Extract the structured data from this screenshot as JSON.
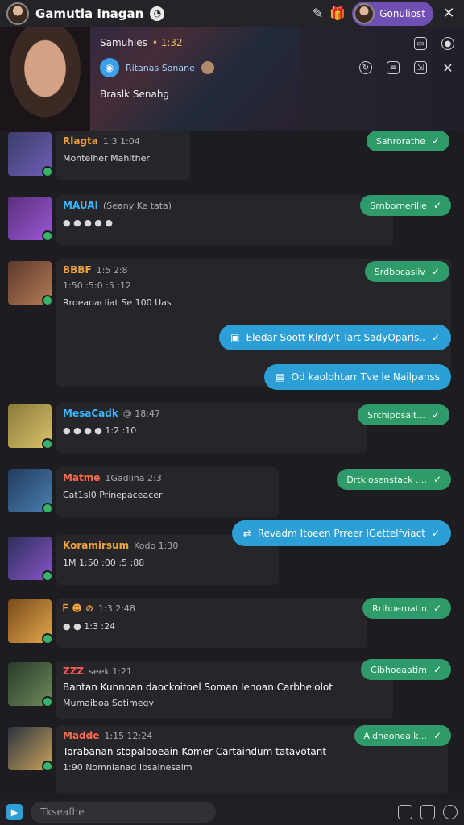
{
  "topbar": {
    "title": "Gamutla Inagan",
    "profile_name": "Gonuliost"
  },
  "hero": {
    "line1": "Samuhies",
    "line1_meta": "• 1:32",
    "sub_label": "Ritanas Sonane",
    "line3": "Braslk Senahg"
  },
  "chats": [
    {
      "name": "Rlagta",
      "name_color": "#f2a23a",
      "time": "1:3 1:04",
      "msg": "Montelher Mahlther",
      "status": "Sahrorathe",
      "avatar": [
        "#3a3e6a",
        "#6f5db5"
      ]
    },
    {
      "name": "MAUAI",
      "name_color": "#37b7ff",
      "time": "(Seany Ke tata)",
      "msg": "● ● ● ● ●",
      "status": "Srnbornerille",
      "avatar": [
        "#5a2f7a",
        "#9b57d6"
      ]
    },
    {
      "name": "BBBF",
      "name_color": "#f2a23a",
      "time": "1:5 2:8",
      "msg": "Rroeaoacliat Se 100 Uas",
      "msg_sub": "1:50 :5:0 :5 :12",
      "status": "Srdbocasiiv",
      "avatar": [
        "#5c3a2c",
        "#b57a56"
      ]
    },
    {
      "name": "MesaCadk",
      "name_color": "#37b7ff",
      "time": "@ 18:47",
      "msg": "● ● ● ● 1:2 :10",
      "status": "Srchipbsalt...",
      "avatar": [
        "#8a7a3a",
        "#d8c26a"
      ]
    },
    {
      "name": "Matme",
      "name_color": "#ff6b4a",
      "time": "1Gadiina 2:3",
      "msg": "Cat1sI0 Prinepaceacer",
      "status": "Drtklosenstack ....",
      "avatar": [
        "#223b5c",
        "#4a7fb0"
      ]
    },
    {
      "name": "Koramirsum",
      "name_color": "#f2a23a",
      "time": "Kodo 1:30",
      "msg": "1M 1:50 :00 :5 :88",
      "status": "",
      "avatar": [
        "#2c2f5a",
        "#8a54c8"
      ]
    },
    {
      "name": "ᖴ ☻ ⊘",
      "name_color": "#f2a23a",
      "time": "1:3 2:48",
      "msg": "● ● 1:3 :24",
      "status": "Rrihoeroatin",
      "avatar": [
        "#7a4a1a",
        "#e0a84a"
      ]
    },
    {
      "name": "ZZZ",
      "name_color": "#ff5a5a",
      "time": "seek 1:21",
      "msg": "Bantan Kunnoan daockoitoel Soman Ienoan Carbheiolot",
      "msg2": "Mumaiboa Sotimegy",
      "status": "Cibhoeaatim",
      "avatar": [
        "#2a3a2a",
        "#6c8a5a"
      ]
    },
    {
      "name": "Madde",
      "name_color": "#ff6b4a",
      "time": "1:15 12:24",
      "msg": "Torabanan stopalboeain Komer Cartaindum tatavotant",
      "msg2": "1:90 Nomnlanad Ibsainesaim",
      "status": "Aldheonealk...",
      "avatar": [
        "#2b3440",
        "#c9a25a"
      ]
    }
  ],
  "blue_pills": [
    "Eledar Soott Klrdy't Tart SadyOparis..",
    "Od kaolohtarr Tve le Nailpanss",
    "Revadm Itoeen Prreer IGettelfviact"
  ],
  "input": {
    "placeholder": "Tkseafhe"
  }
}
